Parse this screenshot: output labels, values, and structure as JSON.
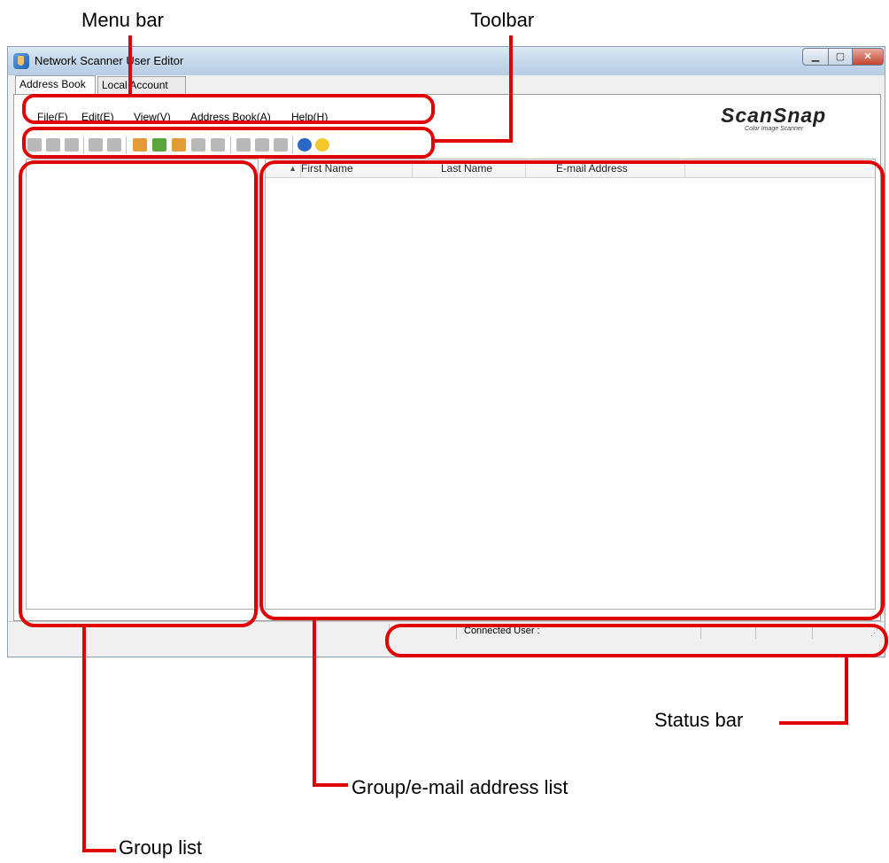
{
  "window": {
    "title": "Network Scanner User Editor"
  },
  "tabs": [
    "Address Book",
    "Local Account"
  ],
  "menu": [
    "File(F)",
    "Edit(E)",
    "View(V)",
    "Address Book(A)",
    "Help(H)"
  ],
  "logo": {
    "main": "ScanSnap",
    "sub": "Color Image Scanner"
  },
  "list": {
    "columns": [
      "First Name",
      "Last Name",
      "E-mail Address"
    ],
    "sort_indicator": "▲"
  },
  "statusbar": {
    "connected_label": "Connected User :"
  },
  "callouts": {
    "menu_bar": "Menu bar",
    "toolbar": "Toolbar",
    "status_bar": "Status bar",
    "email_list": "Group/e-mail address list",
    "group_list": "Group list"
  },
  "colors": {
    "callout_red": "#e00000",
    "titlebar": "#c7d9ec"
  }
}
